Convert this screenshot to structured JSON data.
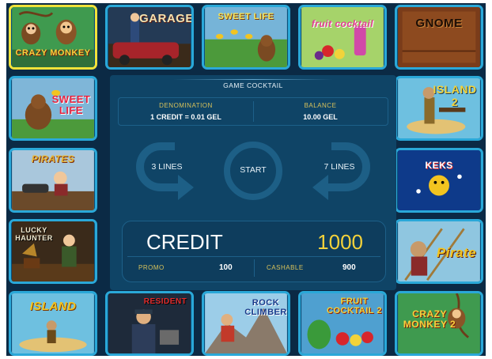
{
  "games": [
    {
      "label": "CRAZY MONKEY",
      "selected": true
    },
    {
      "label": "GARAGE"
    },
    {
      "label": "SWEET LIFE"
    },
    {
      "label": "fruit cocktail"
    },
    {
      "label": "GNOME"
    },
    {
      "label": "SWEET LIFE"
    },
    {
      "label": "ISLAND 2"
    },
    {
      "label": "PIRATES"
    },
    {
      "label": "KEKS"
    },
    {
      "label": "LUCKY HAUNTER"
    },
    {
      "label": "Pirate"
    },
    {
      "label": "ISLAND"
    },
    {
      "label": "RESIDENT"
    },
    {
      "label": "ROCK CLIMBER"
    },
    {
      "label": "FRUIT COCKTAIL 2"
    },
    {
      "label": "CRAZY MONKEY 2"
    }
  ],
  "panel": {
    "title": "GAME COCKTAIL",
    "denomination_label": "DENOMINATION",
    "denomination_value": "1 CREDIT = 0.01 GEL",
    "balance_label": "BALANCE",
    "balance_value": "10.00 GEL",
    "lines_left": "3 LINES",
    "start": "START",
    "lines_right": "7 LINES",
    "credit_label": "CREDIT",
    "credit_value": "1000",
    "promo_label": "PROMO",
    "promo_value": "100",
    "cashable_label": "CASHABLE",
    "cashable_value": "900"
  },
  "colors": {
    "background": "#0b2a45",
    "panel": "#0f4466",
    "tile_border": "#2aa8d8",
    "selected_border": "#f0e23a",
    "caption": "#d8c25a",
    "credit_value": "#f4d23a",
    "arrow": "#1d5f86"
  },
  "icons": {
    "left_arrow": "curved-arrow-left-icon",
    "start_ring": "start-ring-icon",
    "right_arrow": "curved-arrow-right-icon"
  }
}
